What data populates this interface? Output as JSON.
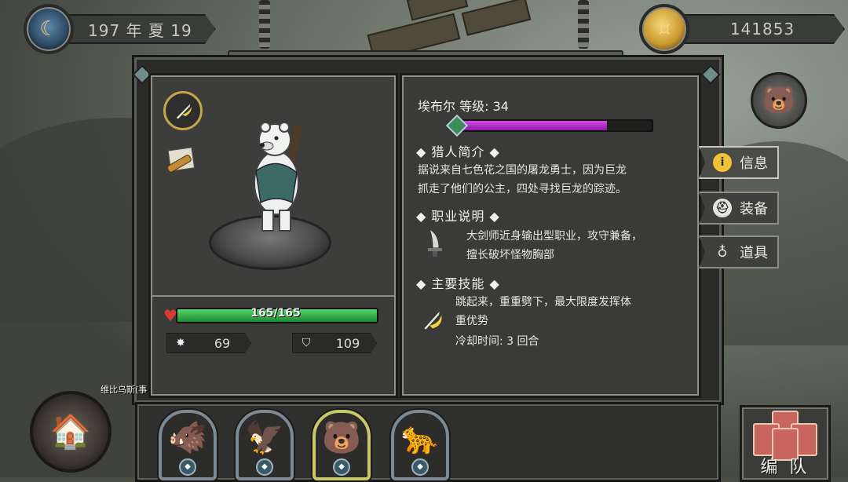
{
  "date": "197 年 夏 19",
  "gold": "141853",
  "hero": {
    "name_level": "埃布尔  等级: 34",
    "xp_fraction": 0.77,
    "hp_text": "165/165",
    "hp_fraction": 1.0,
    "attack": "69",
    "defense": "109"
  },
  "sections": {
    "intro_title": "◆  猎人简介  ◆",
    "intro_text_1": "据说来自七色花之国的屠龙勇士，因为巨龙",
    "intro_text_2": "抓走了他们的公主，四处寻找巨龙的踪迹。",
    "class_title": "◆  职业说明  ◆",
    "class_text_1": "大剑师近身输出型职业，攻守兼备，",
    "class_text_2": "擅长破坏怪物胸部",
    "skill_title": "◆  主要技能  ◆",
    "skill_text_1": "跳起来，重重劈下，最大限度发挥体",
    "skill_text_2": "重优势",
    "skill_cooldown": "冷却时间: 3 回合"
  },
  "tabs": [
    {
      "label": "信息",
      "icon": "info-icon",
      "active": true
    },
    {
      "label": "装备",
      "icon": "helmet-icon",
      "active": false
    },
    {
      "label": "道具",
      "icon": "pouch-icon",
      "active": false
    }
  ],
  "bottom": {
    "house_label": "维比乌斯(事",
    "team_label": "编 队"
  },
  "colors": {
    "hp": "#34b04a",
    "xp": "#b836cc",
    "selected_slot": "#c8c86a"
  }
}
